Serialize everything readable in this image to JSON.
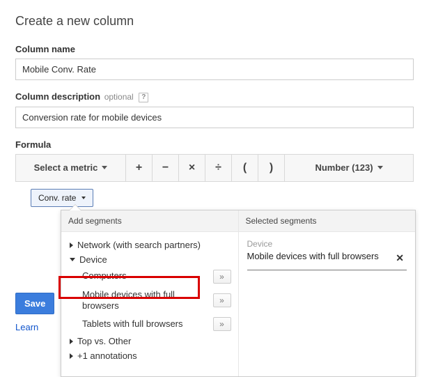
{
  "title": "Create a new column",
  "name_label": "Column name",
  "name_value": "Mobile Conv. Rate",
  "desc_label": "Column description",
  "desc_optional": "optional",
  "desc_help": "?",
  "desc_value": "Conversion rate for mobile devices",
  "formula_label": "Formula",
  "metric_select": "Select a metric",
  "ops": {
    "plus": "+",
    "minus": "−",
    "times": "×",
    "divide": "÷",
    "lparen": "(",
    "rparen": ")"
  },
  "number_format": "Number (123)",
  "conv_chip": "Conv. rate",
  "segments": {
    "add_header": "Add segments",
    "selected_header": "Selected segments",
    "groups": {
      "network": "Network (with search partners)",
      "device": "Device",
      "top_other": "Top vs. Other",
      "annotations": "+1 annotations"
    },
    "device_items": {
      "computers": "Computers",
      "mobile": "Mobile devices with full browsers",
      "tablets": "Tablets with full browsers"
    },
    "add_btn": "»",
    "selected": {
      "category": "Device",
      "value": "Mobile devices with full browsers",
      "remove": "✕"
    }
  },
  "save_label": "Save",
  "learn_label": "Learn"
}
